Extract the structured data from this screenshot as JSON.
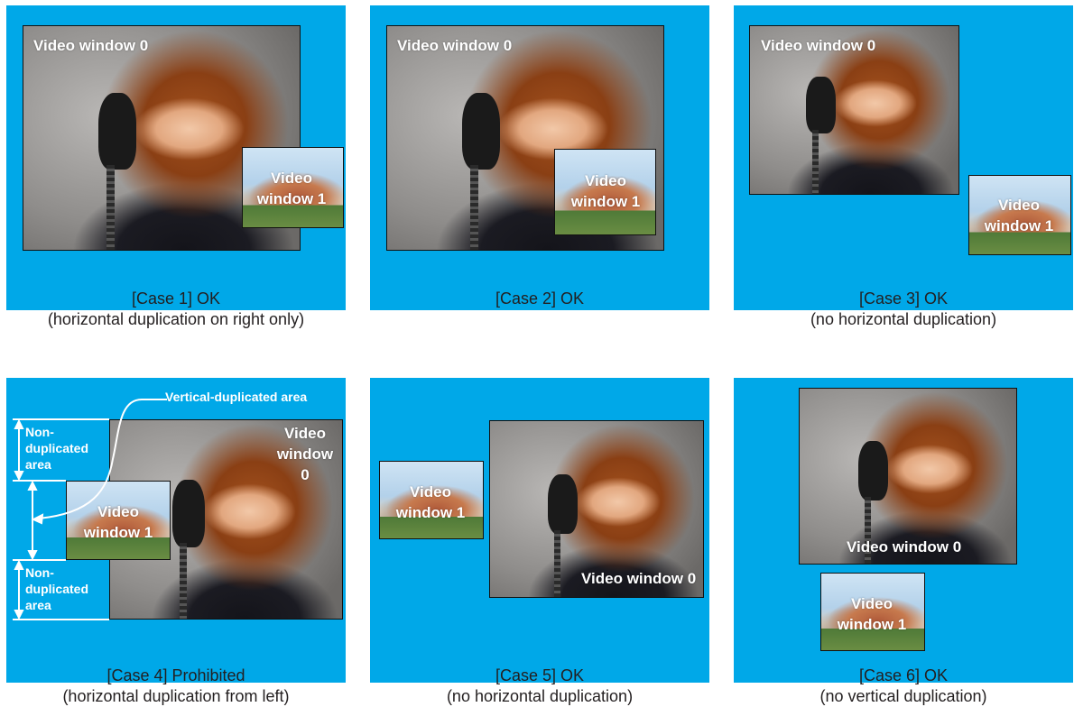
{
  "labels": {
    "video_window_0": "Video window 0",
    "video": "Video",
    "window_1": "window 1",
    "window": "window",
    "zero": "0"
  },
  "case4": {
    "vertical_duplicated_area": "Vertical-duplicated area",
    "non": "Non-",
    "duplicated": "duplicated",
    "area": "area"
  },
  "captions": [
    {
      "line1": "[Case 1] OK",
      "line2": "(horizontal duplication on right only)"
    },
    {
      "line1": "[Case 2] OK",
      "line2": ""
    },
    {
      "line1": "[Case 3] OK",
      "line2": "(no horizontal duplication)"
    },
    {
      "line1": "[Case 4] Prohibited",
      "line2": "(horizontal duplication from left)"
    },
    {
      "line1": "[Case 5] OK",
      "line2": "(no horizontal duplication)"
    },
    {
      "line1": "[Case 6] OK",
      "line2": "(no vertical duplication)"
    }
  ],
  "colors": {
    "background": "#00a8e8",
    "label": "#ffffff",
    "caption": "#231f20"
  }
}
